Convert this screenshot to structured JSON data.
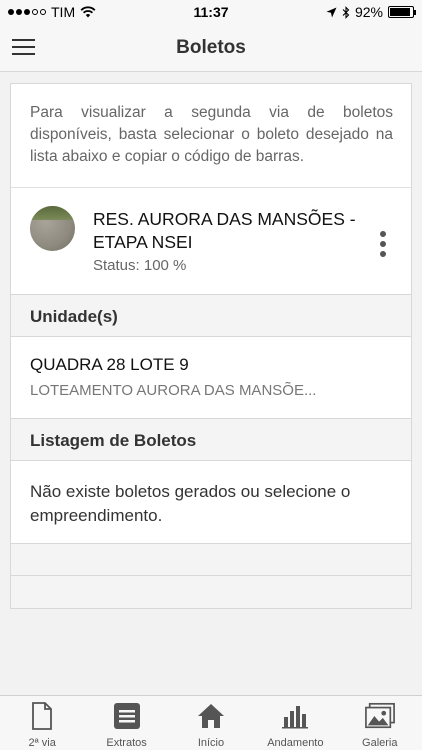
{
  "status_bar": {
    "carrier": "TIM",
    "time": "11:37",
    "battery": "92%",
    "battery_level": 0.92
  },
  "nav": {
    "title": "Boletos"
  },
  "intro": {
    "text": "Para visualizar a segunda via de boletos disponíveis, basta selecionar o boleto desejado na lista abaixo e copiar o código de barras."
  },
  "project": {
    "name": "RES. AURORA DAS MANSÕES - ETAPA NSEI",
    "status": "Status: 100 %"
  },
  "units": {
    "header": "Unidade(s)",
    "items": [
      {
        "title": "QUADRA 28 LOTE 9",
        "subtitle": "LOTEAMENTO AURORA DAS MANSÕE..."
      }
    ]
  },
  "boletos": {
    "header": "Listagem de Boletos",
    "empty_message": "Não existe boletos gerados ou selecione o empreendimento."
  },
  "tabs": [
    {
      "label": "2ª via",
      "icon": "document-icon"
    },
    {
      "label": "Extratos",
      "icon": "list-icon"
    },
    {
      "label": "Início",
      "icon": "home-icon"
    },
    {
      "label": "Andamento",
      "icon": "bar-chart-icon"
    },
    {
      "label": "Galeria",
      "icon": "gallery-icon"
    }
  ],
  "colors": {
    "icon": "#555555",
    "text_muted": "#666666",
    "header_bg": "#f4f4f4"
  }
}
